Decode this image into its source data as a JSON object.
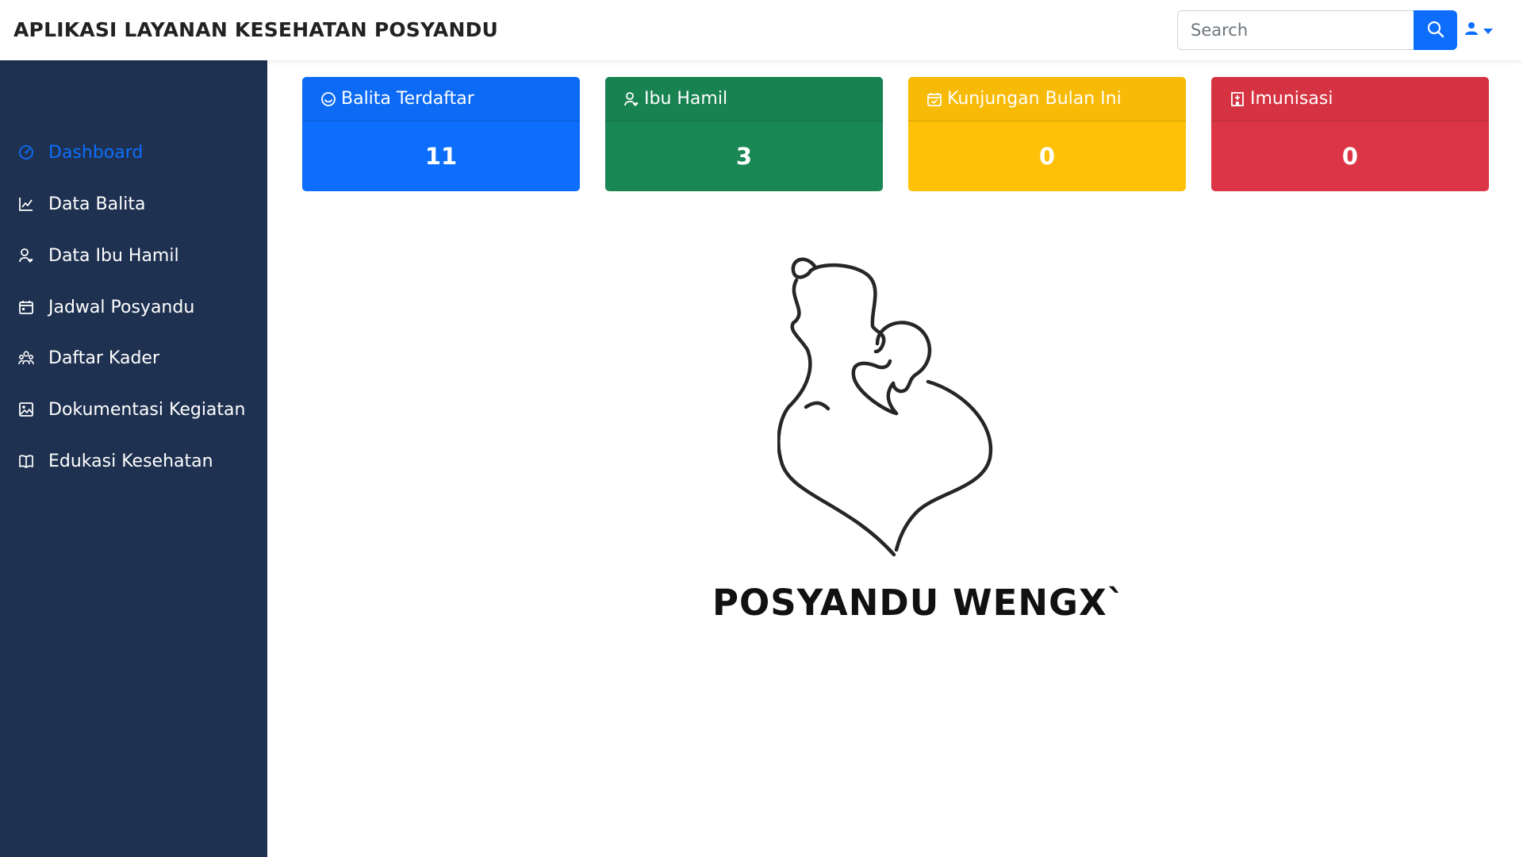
{
  "navbar": {
    "brand": "APLIKASI LAYANAN KESEHATAN POSYANDU",
    "search_placeholder": "Search"
  },
  "sidebar": {
    "items": [
      {
        "label": "Dashboard",
        "icon": "gauge-icon",
        "active": true
      },
      {
        "label": "Data Balita",
        "icon": "chart-line-icon"
      },
      {
        "label": "Data Ibu Hamil",
        "icon": "person-heart-icon"
      },
      {
        "label": "Jadwal Posyandu",
        "icon": "calendar-icon"
      },
      {
        "label": "Daftar Kader",
        "icon": "people-icon"
      },
      {
        "label": "Dokumentasi Kegiatan",
        "icon": "image-icon"
      },
      {
        "label": "Edukasi Kesehatan",
        "icon": "book-icon"
      }
    ]
  },
  "cards": [
    {
      "title": "Balita Terdaftar",
      "value": "11",
      "color": "#0d6efd",
      "icon": "smile-icon"
    },
    {
      "title": "Ibu Hamil",
      "value": "3",
      "color": "#198754",
      "icon": "person-heart-icon"
    },
    {
      "title": "Kunjungan Bulan Ini",
      "value": "0",
      "color": "#ffc107",
      "icon": "calendar-check-icon"
    },
    {
      "title": "Imunisasi",
      "value": "0",
      "color": "#dc3545",
      "icon": "hospital-icon"
    }
  ],
  "logo": {
    "text": "POSYANDU WENGX`"
  },
  "colors": {
    "sidebar_bg": "#1f3150",
    "accent": "#0d6efd"
  }
}
